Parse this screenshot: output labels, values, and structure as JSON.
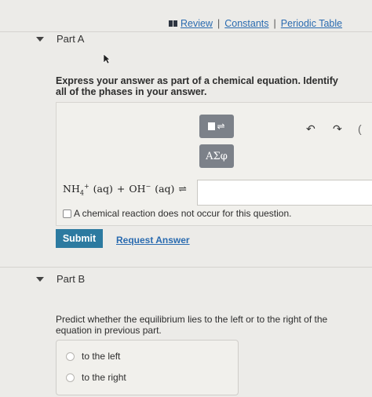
{
  "links": {
    "review": "Review",
    "constants": "Constants",
    "periodic_table": "Periodic Table",
    "separator": "|"
  },
  "part_a": {
    "title": "Part A",
    "instructions": "Express your answer as part of a chemical equation. Identify all of the phases in your answer.",
    "toolbar": {
      "greek": "ΑΣφ",
      "template_symbol": "⇌",
      "undo": "↶",
      "redo": "↷",
      "paren": "("
    },
    "equation": {
      "nh": "NH",
      "nh_sub": "4",
      "nh_sup": "+",
      "aq1": "(aq)",
      "plus": "+",
      "oh": "OH",
      "oh_sup": "−",
      "aq2": "(aq)",
      "arrow": "⇌"
    },
    "answer_value": "",
    "no_reaction_label": "A chemical reaction does not occur for this question.",
    "submit_label": "Submit",
    "request_answer_label": "Request Answer"
  },
  "part_b": {
    "title": "Part B",
    "prompt": "Predict whether the equilibrium lies to the left or to the right of the equation in previous part.",
    "options": [
      "to the left",
      "to the right"
    ]
  }
}
